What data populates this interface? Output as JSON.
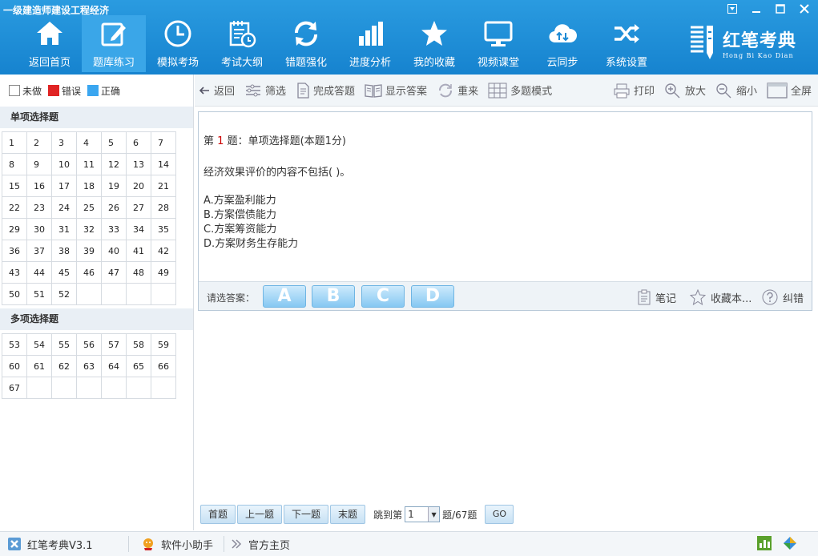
{
  "window": {
    "title": "一级建造师建设工程经济"
  },
  "nav": [
    {
      "label": "返回首页",
      "icon": "home-icon"
    },
    {
      "label": "题库练习",
      "icon": "edit-icon",
      "active": true
    },
    {
      "label": "模拟考场",
      "icon": "clock-icon"
    },
    {
      "label": "考试大纲",
      "icon": "calendar-doc-icon"
    },
    {
      "label": "错题强化",
      "icon": "refresh-icon"
    },
    {
      "label": "进度分析",
      "icon": "bar-chart-icon"
    },
    {
      "label": "我的收藏",
      "icon": "star-icon"
    },
    {
      "label": "视频课堂",
      "icon": "monitor-icon"
    },
    {
      "label": "云同步",
      "icon": "cloud-sync-icon"
    },
    {
      "label": "系统设置",
      "icon": "shuffle-icon"
    }
  ],
  "logo": {
    "cn": "红笔考典",
    "en": "Hong Bi Kao Dian"
  },
  "legend": [
    {
      "label": "未做",
      "color": "#ffffff"
    },
    {
      "label": "错误",
      "color": "#e02424"
    },
    {
      "label": "正确",
      "color": "#3aa6f0"
    }
  ],
  "sections": [
    {
      "title": "单项选择题",
      "numbers": [
        "1",
        "2",
        "3",
        "4",
        "5",
        "6",
        "7",
        "8",
        "9",
        "10",
        "11",
        "12",
        "13",
        "14",
        "15",
        "16",
        "17",
        "18",
        "19",
        "20",
        "21",
        "22",
        "23",
        "24",
        "25",
        "26",
        "27",
        "28",
        "29",
        "30",
        "31",
        "32",
        "33",
        "34",
        "35",
        "36",
        "37",
        "38",
        "39",
        "40",
        "41",
        "42",
        "43",
        "44",
        "45",
        "46",
        "47",
        "48",
        "49",
        "50",
        "51",
        "52"
      ]
    },
    {
      "title": "多项选择题",
      "numbers": [
        "53",
        "54",
        "55",
        "56",
        "57",
        "58",
        "59",
        "60",
        "61",
        "62",
        "63",
        "64",
        "65",
        "66",
        "67"
      ]
    }
  ],
  "toolbar": {
    "left": [
      {
        "label": "返回",
        "icon": "back-arrow-icon"
      },
      {
        "label": "筛选",
        "icon": "filter-icon"
      },
      {
        "label": "完成答题",
        "icon": "document-icon"
      },
      {
        "label": "显示答案",
        "icon": "book-icon"
      },
      {
        "label": "重来",
        "icon": "redo-icon"
      },
      {
        "label": "多题模式",
        "icon": "grid-icon"
      }
    ],
    "right": [
      {
        "label": "打印",
        "icon": "printer-icon"
      },
      {
        "label": "放大",
        "icon": "zoom-in-icon"
      },
      {
        "label": "缩小",
        "icon": "zoom-out-icon"
      },
      {
        "label": "全屏",
        "icon": "fullscreen-icon"
      }
    ]
  },
  "question": {
    "prefix": "第",
    "number": "1",
    "suffix": "题：单项选择题(本题1分)",
    "stem": "经济效果评价的内容不包括( )。",
    "options": [
      "A.方案盈利能力",
      "B.方案偿债能力",
      "C.方案筹资能力",
      "D.方案财务生存能力"
    ]
  },
  "answer": {
    "label": "请选答案：",
    "choices": [
      "A",
      "B",
      "C",
      "D"
    ],
    "actions": [
      {
        "label": "笔记",
        "icon": "note-icon"
      },
      {
        "label": "收藏本...",
        "icon": "star-outline-icon"
      },
      {
        "label": "纠错",
        "icon": "question-circle-icon"
      }
    ]
  },
  "pager": {
    "first": "首题",
    "prev": "上一题",
    "next": "下一题",
    "last": "末题",
    "jump_prefix": "跳到第",
    "jump_value": "1",
    "jump_suffix": "题/67题",
    "go": "GO"
  },
  "status": {
    "app": "红笔考典V3.1",
    "helper": "软件小助手",
    "home": "官方主页"
  }
}
